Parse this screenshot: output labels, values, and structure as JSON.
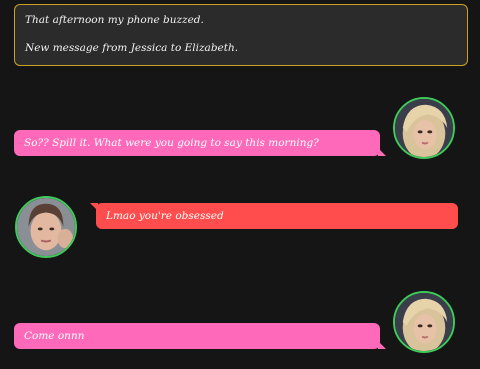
{
  "narration": {
    "line1": "That afternoon my phone buzzed.",
    "line2": "New message from Jessica to Elizabeth."
  },
  "messages": [
    {
      "sender_avatar": "jessica-avatar",
      "side": "right",
      "color": "#ff69b9",
      "text": "So?? Spill it. What were you going to say this morning?"
    },
    {
      "sender_avatar": "elizabeth-avatar",
      "side": "left",
      "color": "#ff4d4d",
      "text": "Lmao you're obsessed"
    },
    {
      "sender_avatar": "jessica-avatar",
      "side": "right",
      "color": "#ff69b9",
      "text": "Come onnn"
    }
  ],
  "colors": {
    "background": "#151515",
    "narration_border": "#c9a227",
    "avatar_ring": "#3ec95a",
    "pink_bubble": "#ff69b9",
    "red_bubble": "#ff4d4d"
  }
}
